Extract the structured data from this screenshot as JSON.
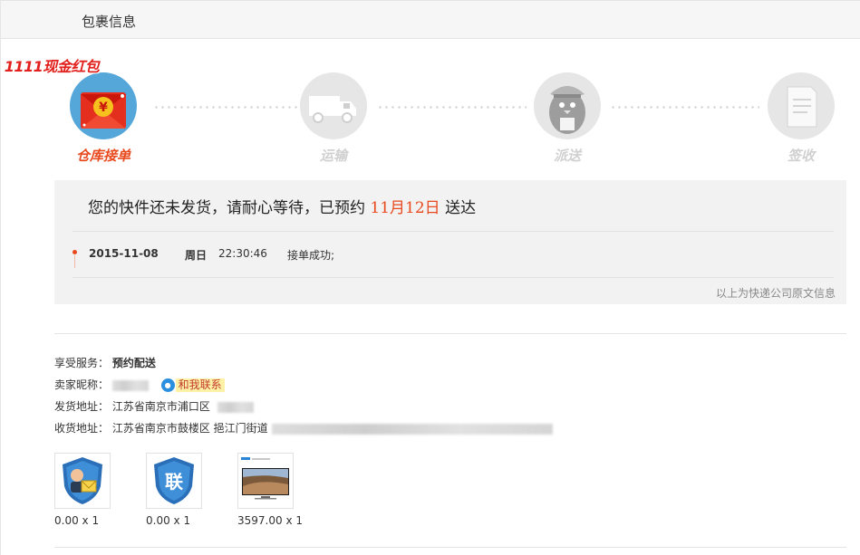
{
  "header": {
    "title": "包裹信息"
  },
  "promo": {
    "text": "1111现金红包"
  },
  "steps": [
    {
      "label": "仓库接单",
      "icon": "red-envelope-icon",
      "active": true
    },
    {
      "label": "运输",
      "icon": "truck-icon",
      "active": false
    },
    {
      "label": "派送",
      "icon": "courier-icon",
      "active": false
    },
    {
      "label": "签收",
      "icon": "document-icon",
      "active": false
    }
  ],
  "status": {
    "message_prefix": "您的快件还未发货，请耐心等待，已预约",
    "message_date": "11月12日",
    "message_suffix": "送达",
    "log": {
      "date": "2015-11-08",
      "weekday": "周日",
      "time": "22:30:46",
      "text": "接单成功;"
    },
    "source_note": "以上为快递公司原文信息"
  },
  "info": {
    "service_label": "享受服务：",
    "service_value": "预约配送",
    "seller_label": "卖家昵称：",
    "contact_label": "和我联系",
    "ship_from_label": "发货地址：",
    "ship_from_value": "江苏省南京市浦口区",
    "ship_to_label": "收货地址：",
    "ship_to_value": "江苏省南京市鼓楼区 挹江门街道"
  },
  "products": [
    {
      "icon": "delivery-shield-icon",
      "price": "0.00 x 1"
    },
    {
      "icon": "lian-shield-icon",
      "glyph": "联",
      "price": "0.00 x 1"
    },
    {
      "icon": "tv-product-icon",
      "price": "3597.00 x 1"
    }
  ],
  "colors": {
    "accent": "#e8491d",
    "active_circle": "#55a7da",
    "inactive": "#d0d0d0"
  }
}
